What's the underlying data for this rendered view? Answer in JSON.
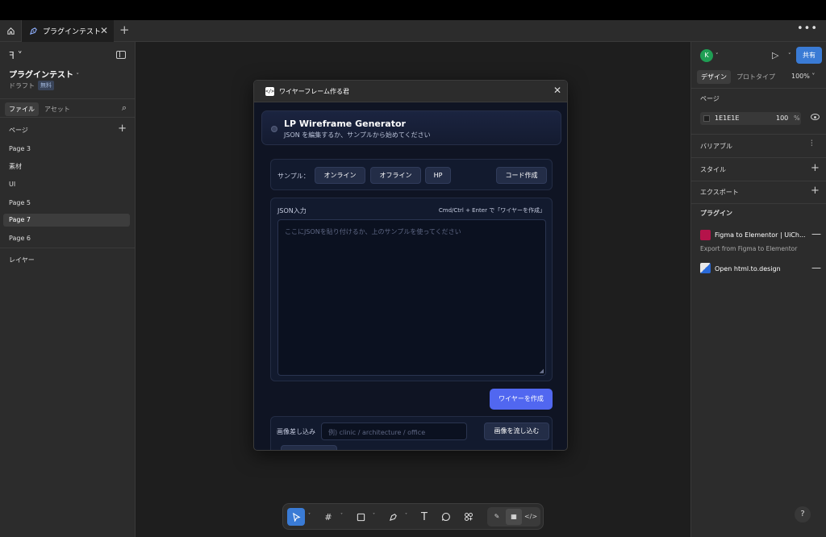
{
  "tabbar": {
    "tab_title": "プラグインテスト",
    "more": "•••"
  },
  "left": {
    "file_title": "プラグインテスト",
    "draft": "ドラフト",
    "badge": "無料",
    "tab_file": "ファイル",
    "tab_assets": "アセット",
    "pages_header": "ページ",
    "pages": [
      "Page 3",
      "素材",
      "UI",
      "Page 5",
      "Page 7",
      "Page 6"
    ],
    "selected_page": "Page 7",
    "layers_header": "レイヤー"
  },
  "right": {
    "avatar": "K",
    "share": "共有",
    "tab_design": "デザイン",
    "tab_prototype": "プロトタイプ",
    "zoom": "100%",
    "page_label": "ページ",
    "bg_hex": "1E1E1E",
    "bg_opacity": "100",
    "bg_pct": "%",
    "variables": "バリアブル",
    "styles": "スタイル",
    "export": "エクスポート",
    "plugins": "プラグイン",
    "plugin1_name": "Figma to Elementor | UiCh...",
    "plugin1_desc": "Export from Figma to Elementor",
    "plugin2_name": "Open html.to.design",
    "help": "?"
  },
  "modal": {
    "title": "ワイヤーフレーム作る君",
    "hero_title": "LP Wireframe Generator",
    "hero_sub": "JSON を編集するか、サンプルから始めてください",
    "sample_label": "サンプル：",
    "samples": [
      "オンライン",
      "オフライン",
      "HP"
    ],
    "code_button": "コード作成",
    "json_label": "JSON入力",
    "json_hint": "Cmd/Ctrl + Enter で「ワイヤーを作成」",
    "json_placeholder": "ここにJSONを貼り付けるか、上のサンプルを使ってください",
    "generate_button": "ワイヤーを作成",
    "image_label": "画像差し込み",
    "image_placeholder": "例) clinic / architecture / office",
    "image_button": "画像を流し込む"
  },
  "colors": {
    "accent": "#3a7bd5",
    "generate": "#5167f0",
    "avatar": "#1f9e54",
    "canvas": "#1E1E1E"
  }
}
